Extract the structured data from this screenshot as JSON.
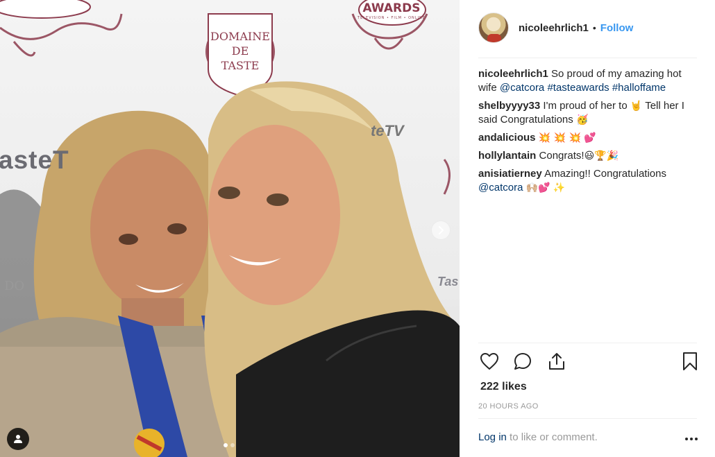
{
  "photo": {
    "backdrop_logos": {
      "logo_line1": "DOMAINE",
      "logo_line2": "DE",
      "logo_line3": "TASTE",
      "awards_title": "AWARDS",
      "awards_sub": "TELEVISION • FILM • ONLINE",
      "tastetv_1": "asteT",
      "tastetv_2": "teTV",
      "tastetv_3": "Tas",
      "do_text": "DO"
    },
    "carousel": {
      "current_slide": 1,
      "total_slides": 2
    }
  },
  "post": {
    "username": "nicoleehrlich1",
    "separator": "•",
    "follow_label": "Follow",
    "caption": {
      "author": "nicoleehrlich1",
      "text": "So proud of my amazing hot wife",
      "mention": "@catcora",
      "hashtag1": "#tasteawards",
      "hashtag2": "#halloffame"
    },
    "comments": [
      {
        "author": "shelbyyyy33",
        "text_before": "I'm proud of her to",
        "emoji1": "🤘",
        "text_after": "Tell her I said Congratulations",
        "emoji2": "🥳"
      },
      {
        "author": "andalicious",
        "emojis": "💥 💥 💥 💕"
      },
      {
        "author": "hollylantain",
        "text": "Congrats!",
        "emojis": "😃🏆🎉"
      },
      {
        "author": "anisiatierney",
        "text": "Amazing!! Congratulations",
        "mention": "@catcora",
        "emojis": "🙌🏼💕 ✨"
      }
    ],
    "likes": "222 likes",
    "timestamp": "20 HOURS AGO",
    "login_link": "Log in",
    "login_rest": "to like or comment."
  },
  "icons": {
    "like": "heart-icon",
    "comment": "comment-bubble-icon",
    "share": "share-icon",
    "save": "bookmark-icon",
    "more": "more-dots-icon",
    "next": "chevron-right-icon",
    "tag": "user-tag-icon"
  }
}
